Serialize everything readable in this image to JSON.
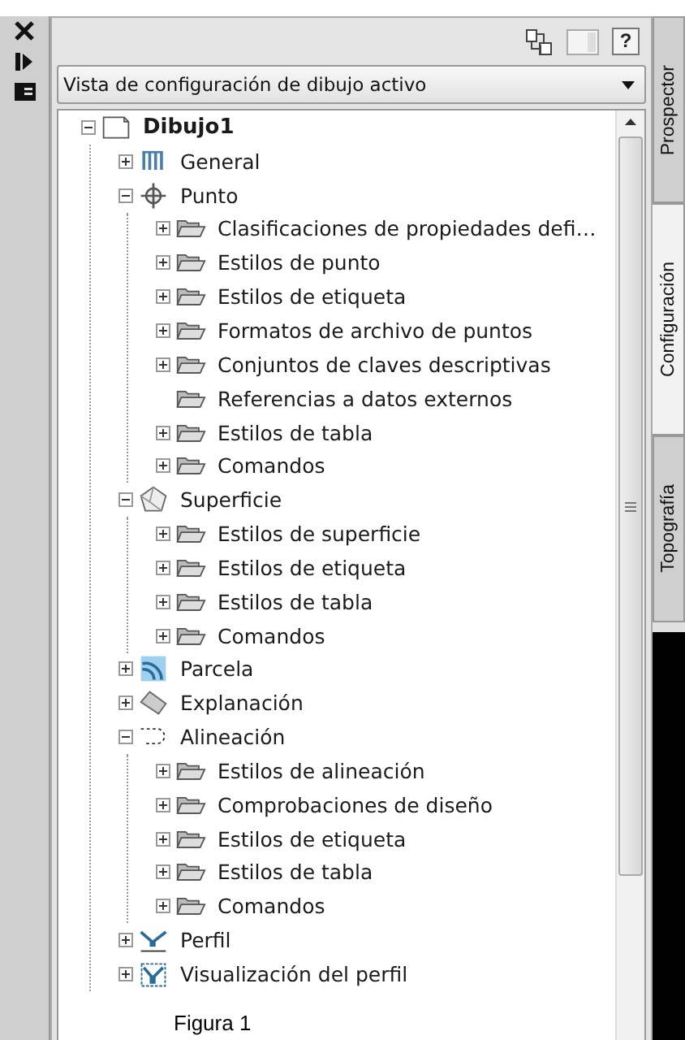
{
  "help_button": {
    "label": "?"
  },
  "view_selector": {
    "value": "Vista de configuración de dibujo activo"
  },
  "tree": [
    {
      "label": "Dibujo1",
      "kind": "document",
      "expanded": true,
      "children": [
        {
          "label": "General",
          "kind": "tools",
          "expanded": false
        },
        {
          "label": "Punto",
          "kind": "point",
          "expanded": true,
          "children": [
            {
              "label": "Clasificaciones de propiedades defi…",
              "kind": "folder",
              "expanded": false
            },
            {
              "label": "Estilos de punto",
              "kind": "folder",
              "expanded": false
            },
            {
              "label": "Estilos de etiqueta",
              "kind": "folder",
              "expanded": false
            },
            {
              "label": "Formatos de archivo de puntos",
              "kind": "folder",
              "expanded": false
            },
            {
              "label": "Conjuntos de claves descriptivas",
              "kind": "folder",
              "expanded": false
            },
            {
              "label": "Referencias a datos externos",
              "kind": "folder"
            },
            {
              "label": "Estilos de tabla",
              "kind": "folder",
              "expanded": false
            },
            {
              "label": "Comandos",
              "kind": "folder",
              "expanded": false
            }
          ]
        },
        {
          "label": "Superficie",
          "kind": "surface",
          "expanded": true,
          "children": [
            {
              "label": "Estilos de superficie",
              "kind": "folder",
              "expanded": false
            },
            {
              "label": "Estilos de etiqueta",
              "kind": "folder",
              "expanded": false
            },
            {
              "label": "Estilos de tabla",
              "kind": "folder",
              "expanded": false
            },
            {
              "label": "Comandos",
              "kind": "folder",
              "expanded": false
            }
          ]
        },
        {
          "label": "Parcela",
          "kind": "parcel",
          "expanded": false
        },
        {
          "label": "Explanación",
          "kind": "grading",
          "expanded": false
        },
        {
          "label": "Alineación",
          "kind": "alignment",
          "expanded": true,
          "children": [
            {
              "label": "Estilos de alineación",
              "kind": "folder",
              "expanded": false
            },
            {
              "label": "Comprobaciones de diseño",
              "kind": "folder",
              "expanded": false
            },
            {
              "label": "Estilos de etiqueta",
              "kind": "folder",
              "expanded": false
            },
            {
              "label": "Estilos de tabla",
              "kind": "folder",
              "expanded": false
            },
            {
              "label": "Comandos",
              "kind": "folder",
              "expanded": false
            }
          ]
        },
        {
          "label": "Perfil",
          "kind": "profile",
          "expanded": false
        },
        {
          "label": "Visualización del perfil",
          "kind": "profile-view",
          "expanded": false
        }
      ]
    }
  ],
  "caption": "Figura 1",
  "side_tabs": [
    {
      "label": "Prospector",
      "selected": false
    },
    {
      "label": "Configuración",
      "selected": true
    },
    {
      "label": "Topografía",
      "selected": false
    }
  ]
}
